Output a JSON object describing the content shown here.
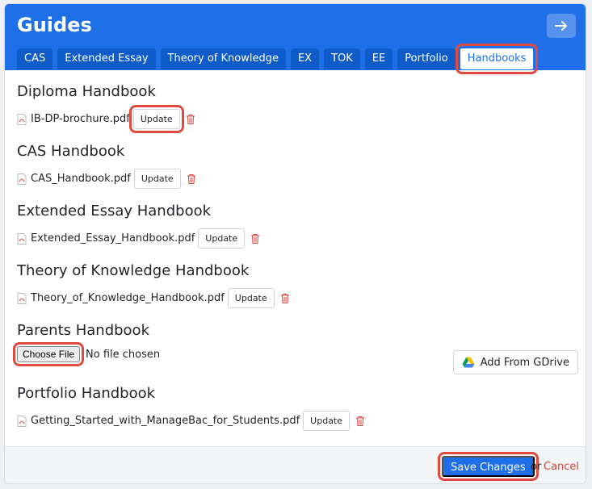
{
  "header": {
    "title": "Guides"
  },
  "tabs": [
    {
      "label": "CAS"
    },
    {
      "label": "Extended Essay"
    },
    {
      "label": "Theory of Knowledge"
    },
    {
      "label": "EX"
    },
    {
      "label": "TOK"
    },
    {
      "label": "EE"
    },
    {
      "label": "Portfolio"
    },
    {
      "label": "Handbooks",
      "active": true
    }
  ],
  "sections": [
    {
      "title": "Diploma Handbook",
      "file": "IB-DP-brochure.pdf",
      "button": "Update"
    },
    {
      "title": "CAS Handbook",
      "file": "CAS_Handbook.pdf",
      "button": "Update"
    },
    {
      "title": "Extended Essay Handbook",
      "file": "Extended_Essay_Handbook.pdf",
      "button": "Update"
    },
    {
      "title": "Theory of Knowledge Handbook",
      "file": "Theory_of_Knowledge_Handbook.pdf",
      "button": "Update"
    },
    {
      "title": "Parents Handbook",
      "choose_file": "Choose File",
      "no_file": "No file chosen",
      "gdrive": "Add From GDrive"
    },
    {
      "title": "Portfolio Handbook",
      "file": "Getting_Started_with_ManageBac_for_Students.pdf",
      "button": "Update"
    }
  ],
  "footer": {
    "save": "Save Changes",
    "or": "or",
    "cancel": "Cancel"
  },
  "colors": {
    "primary": "#1f6fe8",
    "tab_bg": "#0e5bc9",
    "highlight": "#e04a3f",
    "danger": "#d9403a"
  },
  "icons": {
    "header_action": "arrow-right-icon",
    "file": "pdf-file-icon",
    "delete": "trash-icon",
    "gdrive": "google-drive-icon"
  }
}
